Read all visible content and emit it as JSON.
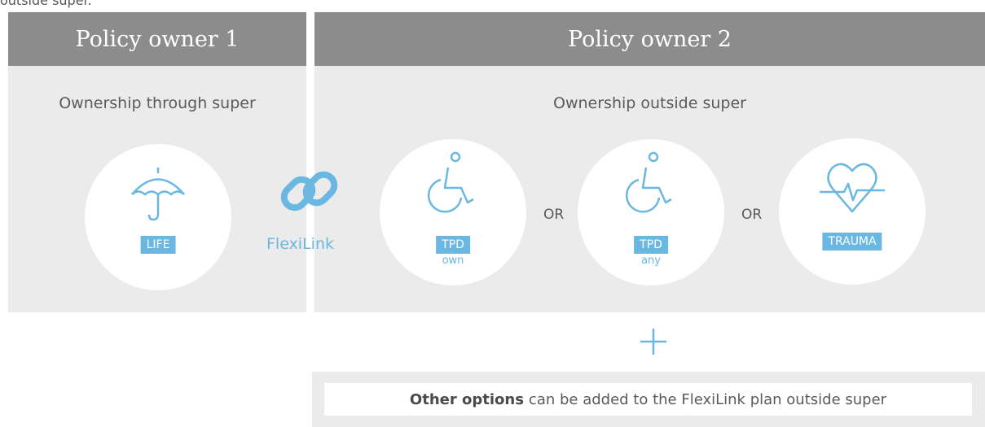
{
  "top_note": "outside super.",
  "owner1": {
    "title": "Policy owner 1",
    "subtitle": "Ownership through super"
  },
  "owner2": {
    "title": "Policy owner 2",
    "subtitle": "Ownership outside super"
  },
  "covers": [
    {
      "icon": "umbrella-icon",
      "label": "LIFE",
      "sub": ""
    },
    {
      "icon": "wheelchair-icon",
      "label": "TPD",
      "sub": "own"
    },
    {
      "icon": "wheelchair-icon",
      "label": "TPD",
      "sub": "any"
    },
    {
      "icon": "heart-pulse-icon",
      "label": "TRAUMA",
      "sub": ""
    }
  ],
  "connector": "OR",
  "flexilink": {
    "icon": "chain-link-icon",
    "label": "FlexiLink"
  },
  "plus_icon": "plus-icon",
  "other_options": {
    "bold": "Other options",
    "rest": "can be added to the FlexiLink plan outside super"
  },
  "colors": {
    "header": "#8c8c8c",
    "panel": "#ebebeb",
    "accent": "#6ab8e2",
    "text": "#5a5a5a"
  }
}
